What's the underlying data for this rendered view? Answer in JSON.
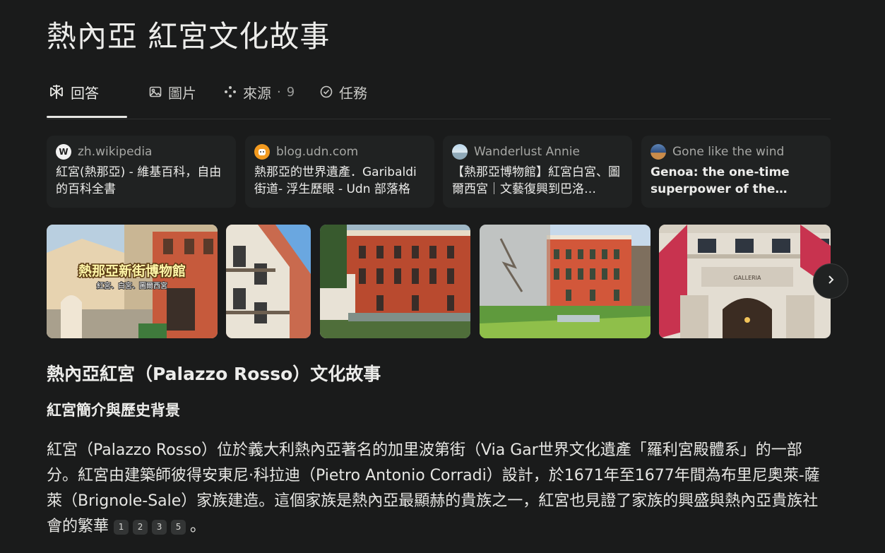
{
  "page": {
    "title": "熱內亞 紅宮文化故事"
  },
  "tabs": [
    {
      "label": "回答",
      "icon": "perplexity-icon"
    },
    {
      "label": "圖片",
      "icon": "image-icon"
    },
    {
      "label": "來源",
      "icon": "sources-icon",
      "count": "9"
    },
    {
      "label": "任務",
      "icon": "check-circle-icon"
    }
  ],
  "sources": [
    {
      "site": "zh.wikipedia",
      "favicon": "W",
      "title": "紅宮(熱那亞) - 維基百科，自由的百科全書"
    },
    {
      "site": "blog.udn.com",
      "favicon": "udn",
      "title": "熱那亞的世界遺產．Garibaldi街道- 浮生歷眼 - Udn 部落格"
    },
    {
      "site": "Wanderlust Annie",
      "favicon": "annie",
      "title": "【熱那亞博物館】紅宮白宮、圖爾西宮｜文藝復興到巴洛…"
    },
    {
      "site": "Gone like the wind",
      "favicon": "wind",
      "title": "Genoa: the one-time superpower of the…"
    }
  ],
  "images": {
    "overlay_title": "熱那亞新街博物館",
    "overlay_subtitle": "紅宮、白宮、圖爾西宮",
    "sign_text": "GALLERIA"
  },
  "answer": {
    "heading": "熱內亞紅宮（Palazzo Rosso）文化故事",
    "subheading": "紅宮簡介與歷史背景",
    "paragraph": "紅宮（Palazzo Rosso）位於義大利熱內亞著名的加里波第街（Via Gar世界文化遺產「羅利宮殿體系」的一部分。紅宮由建築師彼得安東尼·科拉迪（Pietro Antonio Corradi）設計，於1671年至1677年間為布里尼奧萊-薩萊（Brignole-Sale）家族建造。這個家族是熱內亞最顯赫的貴族之一，紅宮也見證了家族的興盛與熱內亞貴族社會的繁華",
    "citations": [
      "1",
      "2",
      "3",
      "5"
    ],
    "end_punct": "。"
  },
  "colors": {
    "background": "#1a1b1b",
    "card": "#202222",
    "palazzo_red": "#b94a2f",
    "accent_text": "#ececea"
  }
}
